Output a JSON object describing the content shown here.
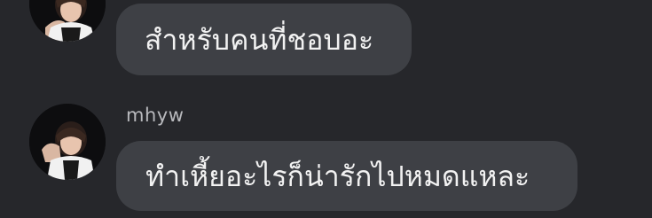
{
  "messages": [
    {
      "sender": "",
      "text": "สำหรับคนที่ชอบอะ"
    },
    {
      "sender": "mhyw",
      "text": "ทำเหี้ยอะไรก็น่ารักไปหมดแหละ"
    }
  ],
  "colors": {
    "background": "#26272b",
    "bubble": "#3e4045",
    "text": "#f2f2f2",
    "sender": "#b8b9bd"
  }
}
